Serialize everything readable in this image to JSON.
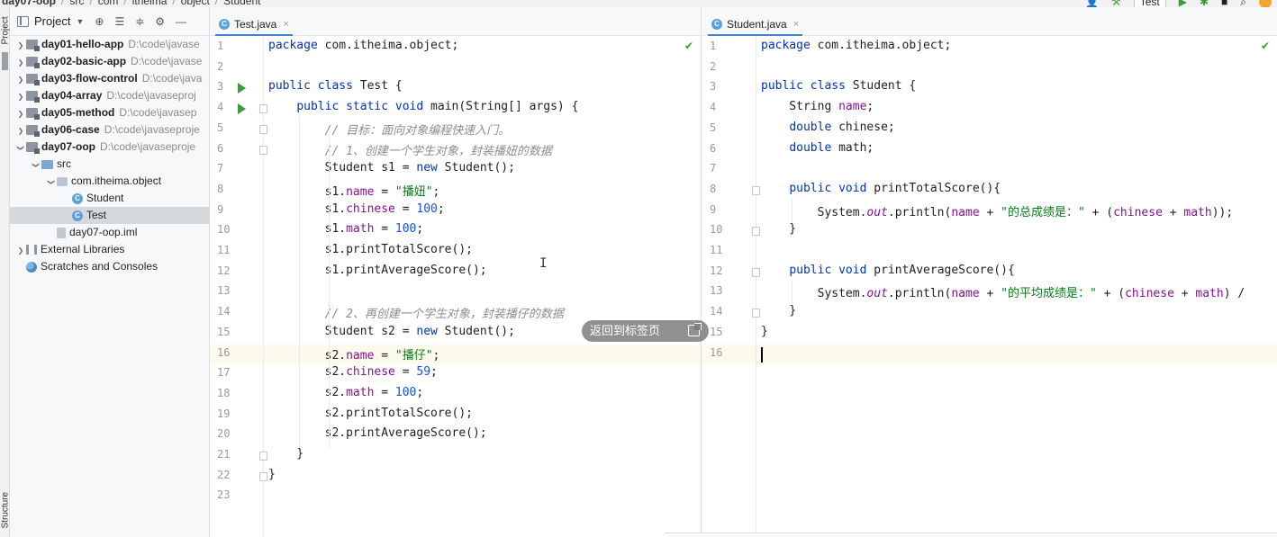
{
  "nav": {
    "crumbs": [
      "day07-oop",
      "src",
      "com",
      "itheima",
      "object",
      "Student"
    ],
    "run_config": "Test"
  },
  "tool_stripe": {
    "top_label": "Project",
    "bottom_label": "Structure"
  },
  "project_panel": {
    "title": "Project",
    "tree": [
      {
        "label": "day01-hello-app",
        "path": "D:\\code\\javase",
        "bold": true,
        "arrow": "›",
        "icon": "module-icon",
        "depth": 0
      },
      {
        "label": "day02-basic-app",
        "path": "D:\\code\\javase",
        "bold": true,
        "arrow": "›",
        "icon": "module-icon",
        "depth": 0
      },
      {
        "label": "day03-flow-control",
        "path": "D:\\code\\java",
        "bold": true,
        "arrow": "›",
        "icon": "module-icon",
        "depth": 0
      },
      {
        "label": "day04-array",
        "path": "D:\\code\\javaseproj",
        "bold": true,
        "arrow": "›",
        "icon": "module-icon",
        "depth": 0
      },
      {
        "label": "day05-method",
        "path": "D:\\code\\javasep",
        "bold": true,
        "arrow": "›",
        "icon": "module-icon",
        "depth": 0
      },
      {
        "label": "day06-case",
        "path": "D:\\code\\javaseproje",
        "bold": true,
        "arrow": "›",
        "icon": "module-icon",
        "depth": 0
      },
      {
        "label": "day07-oop",
        "path": "D:\\code\\javaseproje",
        "bold": true,
        "arrow": "⌄",
        "icon": "module-icon",
        "depth": 0
      },
      {
        "label": "src",
        "path": "",
        "bold": false,
        "arrow": "⌄",
        "icon": "folder-icon",
        "depth": 1
      },
      {
        "label": "com.itheima.object",
        "path": "",
        "bold": false,
        "arrow": "⌄",
        "icon": "package-icon",
        "depth": 2
      },
      {
        "label": "Student",
        "path": "",
        "bold": false,
        "arrow": "",
        "icon": "class-icon",
        "depth": 3
      },
      {
        "label": "Test",
        "path": "",
        "bold": false,
        "arrow": "",
        "icon": "class-icon",
        "depth": 3,
        "selected": true
      },
      {
        "label": "day07-oop.iml",
        "path": "",
        "bold": false,
        "arrow": "",
        "icon": "file-icon",
        "depth": 2
      },
      {
        "label": "External Libraries",
        "path": "",
        "bold": false,
        "arrow": "›",
        "icon": "library-icon",
        "depth": 0
      },
      {
        "label": "Scratches and Consoles",
        "path": "",
        "bold": false,
        "arrow": "",
        "icon": "scratch-icon",
        "depth": 0
      }
    ]
  },
  "editor_left": {
    "tab_label": "Test.java",
    "lines": [
      "package com.itheima.object;",
      "",
      "public class Test {",
      "    public static void main(String[] args) {",
      "        // 目标：面向对象编程快速入门。",
      "        // 1、创建一个学生对象，封装播妞的数据",
      "        Student s1 = new Student();",
      "        s1.name = \"播妞\";",
      "        s1.chinese = 100;",
      "        s1.math = 100;",
      "        s1.printTotalScore();",
      "        s1.printAverageScore();",
      "",
      "        // 2、再创建一个学生对象，封装播仔的数据",
      "        Student s2 = new Student();",
      "        s2.name = \"播仔\";",
      "        s2.chinese = 59;",
      "        s2.math = 100;",
      "        s2.printTotalScore();",
      "        s2.printAverageScore();",
      "    }",
      "}",
      ""
    ],
    "highlighted_line": 16
  },
  "editor_right": {
    "tab_label": "Student.java",
    "lines": [
      "package com.itheima.object;",
      "",
      "public class Student {",
      "    String name;",
      "    double chinese;",
      "    double math;",
      "",
      "    public void printTotalScore(){",
      "        System.out.println(name + \"的总成绩是：\" + (chinese + math));",
      "    }",
      "",
      "    public void printAverageScore(){",
      "        System.out.println(name + \"的平均成绩是：\" + (chinese + math) /",
      "    }",
      "}",
      ""
    ],
    "highlighted_line": 16
  },
  "overlay": {
    "back_to_tab_label": "返回到标签页"
  }
}
